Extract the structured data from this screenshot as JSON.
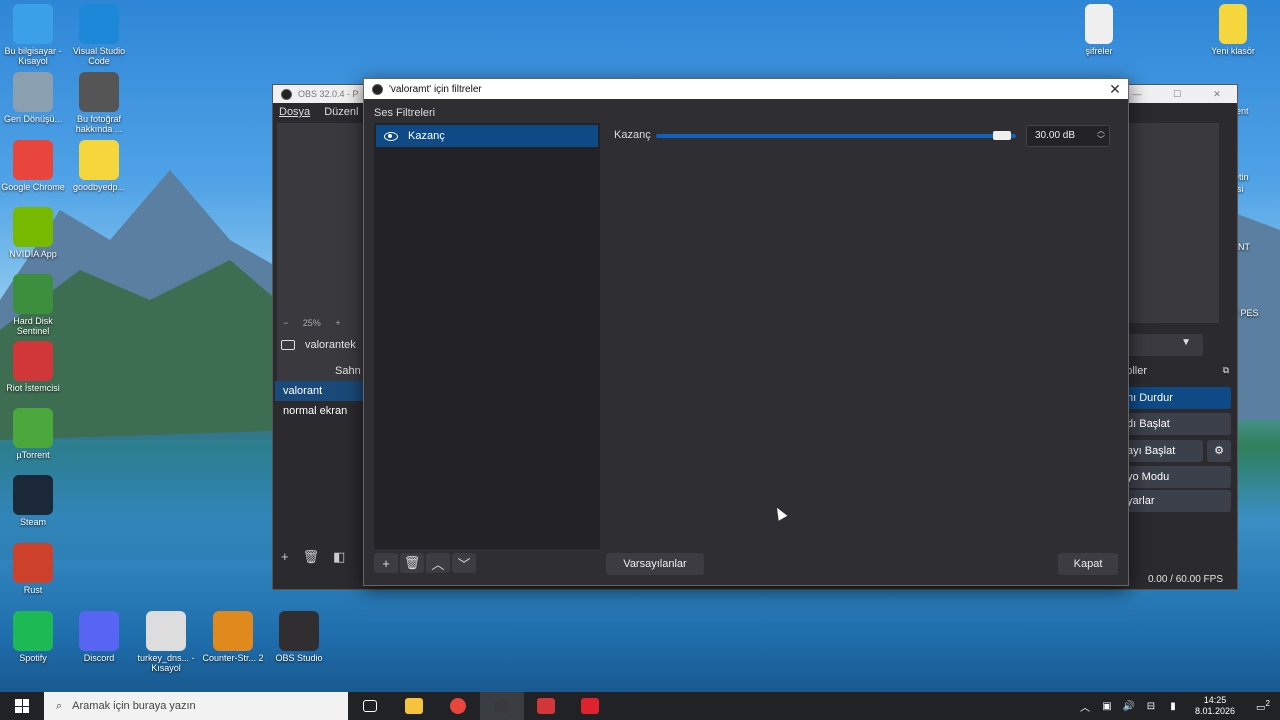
{
  "desktop": {
    "left_icons": [
      {
        "label": "Bu bilgisayar - Kısayol",
        "color": "#3aa0e8"
      },
      {
        "label": "Visual Studio Code",
        "color": "#1e88d8"
      },
      {
        "label": "Geri Dönüşü...",
        "color": "#8aa0b0"
      },
      {
        "label": "Bu fotoğraf hakkında ...",
        "color": "#555555"
      },
      {
        "label": "Google Chrome",
        "color": "#e8453c"
      },
      {
        "label": "goodbyedp...",
        "color": "#f5d63c"
      },
      {
        "label": "NVIDIA App",
        "color": "#76b900"
      },
      {
        "label": "Hard Disk Sentinel",
        "color": "#3c8f3c"
      },
      {
        "label": "Riot İstemcisi",
        "color": "#d13639"
      },
      {
        "label": "µTorrent",
        "color": "#4aa83c"
      },
      {
        "label": "Steam",
        "color": "#1b2838"
      },
      {
        "label": "Rust",
        "color": "#cd412b"
      },
      {
        "label": "Spotify",
        "color": "#1db954"
      },
      {
        "label": "Discord",
        "color": "#5865f2"
      },
      {
        "label": "turkey_dns... - Kısayol",
        "color": "#dddddd"
      },
      {
        "label": "Counter-Str... 2",
        "color": "#e08a1e"
      },
      {
        "label": "OBS Studio",
        "color": "#302e31"
      }
    ],
    "right_icons": [
      {
        "label": "şifreler",
        "color": "#f0f0f0"
      },
      {
        "label": "Yeni klasör",
        "color": "#f5d63c"
      }
    ],
    "right_partial_labels": [
      "lient",
      "letin",
      "esi",
      "ANT",
      "ill PES",
      "1"
    ]
  },
  "obs_main": {
    "title": "OBS 32.0.4 - P",
    "menu": [
      "Dosya",
      "Düzenl"
    ],
    "zoom": "25%",
    "source_name": "valorantek",
    "scenes_header": "Sahn",
    "scenes": [
      "valorant",
      "normal ekran"
    ],
    "controls_header": "troller",
    "controls": [
      "nı Durdur",
      "dı Başlat",
      "ayı Başlat",
      "yo Modu",
      "yarlar"
    ],
    "status_fps": "0.00 / 60.00 FPS"
  },
  "dialog": {
    "title": "'valoramt' için filtreler",
    "section_label": "Ses Filtreleri",
    "filters": [
      {
        "name": "Kazanç",
        "visible": true
      }
    ],
    "property_label": "Kazanç",
    "gain_value": "30.00 dB",
    "gain_fraction": 0.96,
    "defaults_button": "Varsayılanlar",
    "close_button": "Kapat"
  },
  "taskbar": {
    "search_placeholder": "Aramak için buraya yazın",
    "time": "14:25",
    "date": "8.01.2026",
    "notification_count": "2",
    "apps": [
      {
        "name": "task-view",
        "color": "#202225"
      },
      {
        "name": "file-explorer",
        "color": "#f5c33c"
      },
      {
        "name": "chrome",
        "color": "#e8453c"
      },
      {
        "name": "obs",
        "color": "#3a3a3e"
      },
      {
        "name": "riot",
        "color": "#d13639"
      },
      {
        "name": "valorant",
        "color": "#e0222e"
      }
    ]
  }
}
